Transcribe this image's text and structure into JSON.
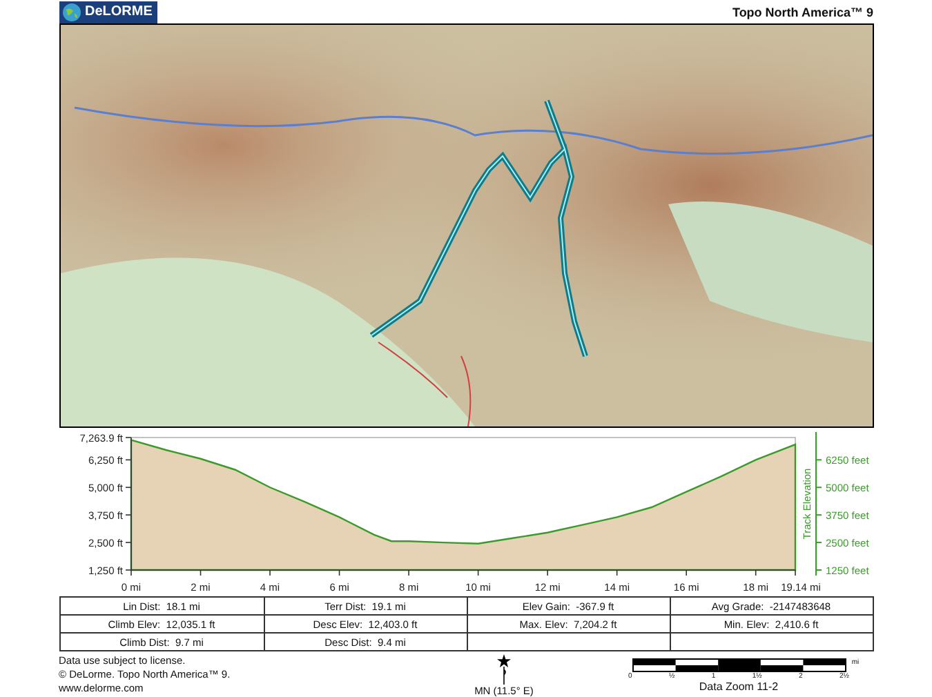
{
  "header": {
    "logo": "DeLORME",
    "title": "Topo North America™ 9"
  },
  "profile": {
    "chart_data": {
      "type": "area",
      "x": [
        0,
        1,
        2,
        3,
        4,
        5,
        6,
        7,
        7.5,
        8,
        9,
        10,
        11,
        12,
        13,
        14,
        15,
        16,
        17,
        18,
        19.14
      ],
      "series": [
        {
          "name": "Track Elevation",
          "color": "#3a9a2a",
          "values": [
            7150,
            6700,
            6300,
            5800,
            5000,
            4350,
            3650,
            2850,
            2560,
            2560,
            2500,
            2450,
            2700,
            2950,
            3300,
            3650,
            4100,
            4800,
            5500,
            6250,
            6950
          ]
        }
      ],
      "xlim": [
        0,
        19.14
      ],
      "ylim": [
        1250,
        7263.9
      ],
      "xticks": [
        {
          "value": 0,
          "label": "0 mi"
        },
        {
          "value": 2,
          "label": "2 mi"
        },
        {
          "value": 4,
          "label": "4 mi"
        },
        {
          "value": 6,
          "label": "6 mi"
        },
        {
          "value": 8,
          "label": "8 mi"
        },
        {
          "value": 10,
          "label": "10 mi"
        },
        {
          "value": 12,
          "label": "12 mi"
        },
        {
          "value": 14,
          "label": "14 mi"
        },
        {
          "value": 16,
          "label": "16 mi"
        },
        {
          "value": 18,
          "label": "18 mi"
        },
        {
          "value": 19.14,
          "label": "19.14 mi"
        }
      ],
      "yticks": [
        {
          "value": 1250,
          "label": "1,250 ft"
        },
        {
          "value": 2500,
          "label": "2,500 ft"
        },
        {
          "value": 3750,
          "label": "3,750 ft"
        },
        {
          "value": 5000,
          "label": "5,000 ft"
        },
        {
          "value": 6250,
          "label": "6,250 ft"
        },
        {
          "value": 7263.9,
          "label": "7,263.9 ft"
        }
      ]
    },
    "right_axis": {
      "tick_labels": [
        "6250 feet",
        "5000 feet",
        "3750 feet",
        "2500 feet",
        "1250 feet"
      ]
    }
  },
  "stats": [
    [
      {
        "label": "Lin Dist:",
        "value": "18.1 mi"
      },
      {
        "label": "Terr Dist:",
        "value": "19.1 mi"
      },
      {
        "label": "Elev Gain:",
        "value": "-367.9 ft"
      },
      {
        "label": "Avg Grade:",
        "value": "-2147483648"
      }
    ],
    [
      {
        "label": "Climb Elev:",
        "value": "12,035.1 ft"
      },
      {
        "label": "Desc Elev:",
        "value": "12,403.0 ft"
      },
      {
        "label": "Max. Elev:",
        "value": "7,204.2 ft"
      },
      {
        "label": "Min. Elev:",
        "value": "2,410.6 ft"
      }
    ],
    [
      {
        "label": "Climb Dist:",
        "value": "9.7 mi"
      },
      {
        "label": "Desc Dist:",
        "value": "9.4 mi"
      }
    ]
  ],
  "footer": {
    "notes": [
      "Data use subject to license.",
      "© DeLorme. Topo North America™ 9.",
      "www.delorme.com"
    ],
    "declination": "MN (11.5° E)",
    "scale": {
      "labels": [
        "0",
        "½",
        "1",
        "1½",
        "2",
        "2½"
      ],
      "unit": "mi",
      "zoom": "Data Zoom 11-2"
    }
  }
}
